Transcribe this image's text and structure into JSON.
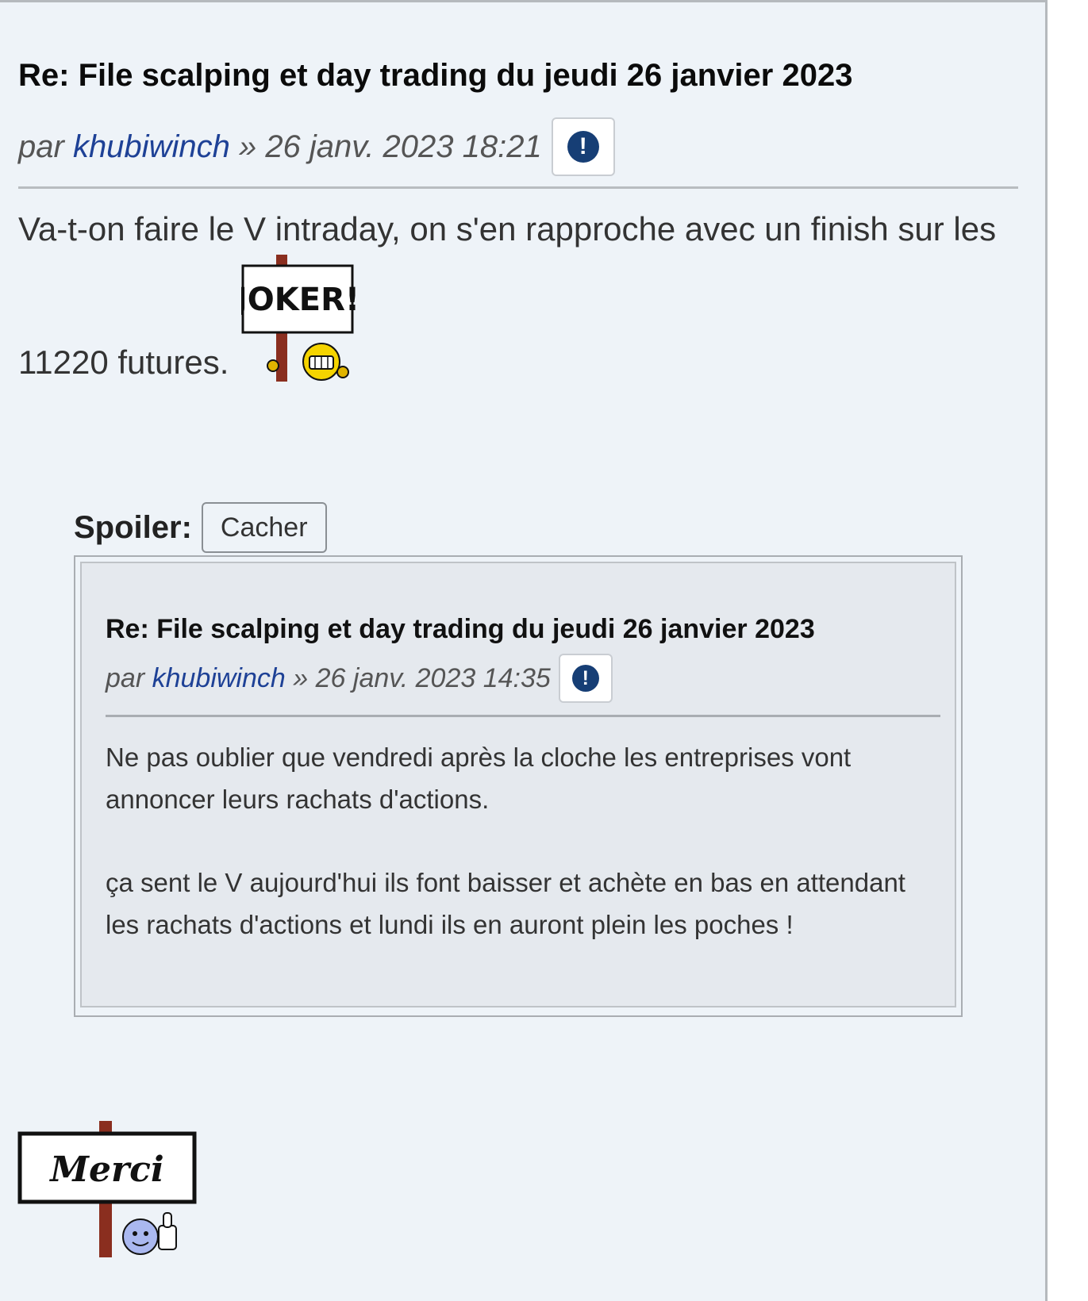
{
  "post": {
    "title": "Re: File scalping et day trading du jeudi 26 janvier 2023",
    "meta": {
      "prefix": "par ",
      "author": "khubiwinch",
      "separator": " » ",
      "date": "26 janv. 2023 18:21"
    },
    "report_icon": "exclamation-circle-icon",
    "body_line1": "Va-t-on faire le V intraday, on s'en rapproche avec un finish sur les",
    "body_line2": "11220 futures.",
    "smiley_joker": {
      "name": "joker-sign-smiley",
      "text": "JOKER!"
    },
    "spoiler": {
      "label": "Spoiler:",
      "button_label": "Cacher"
    },
    "quote": {
      "title": "Re: File scalping et day trading du jeudi 26 janvier 2023",
      "meta": {
        "prefix": "par ",
        "author": "khubiwinch",
        "separator": " » ",
        "date": "26 janv. 2023 14:35"
      },
      "paragraphs": [
        "Ne pas oublier que vendredi après la cloche les entreprises vont annoncer leurs rachats d'actions.",
        "ça sent le V aujourd'hui ils font baisser et achète en bas en attendant les rachats d'actions et lundi ils en auront plein les poches !"
      ]
    },
    "smiley_merci": {
      "name": "merci-sign-smiley",
      "text": "Merci"
    }
  },
  "colors": {
    "post_background": "#eef3f8",
    "quote_background": "#e5e9ee",
    "author_link": "#1e4196",
    "report_icon": "#163e75"
  }
}
